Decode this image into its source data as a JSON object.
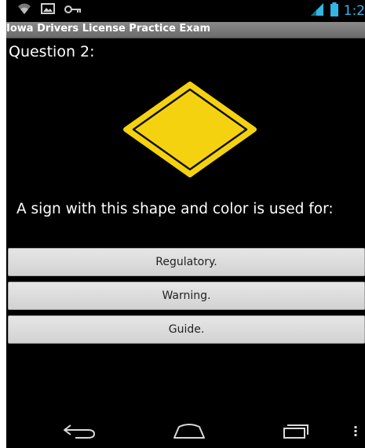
{
  "app": {
    "title": "Iowa Drivers License Practice Exam"
  },
  "status_bar": {
    "time": "1:2",
    "icons": [
      "wifi-icon",
      "image-icon",
      "key-icon",
      "signal-icon",
      "battery-icon"
    ],
    "accent_color": "#33b5e5"
  },
  "question": {
    "number_label": "Question 2:",
    "sign_icon": "diamond-warning-sign-icon",
    "sign_color": "#f5d20f",
    "text": "A sign with this shape and color is used for:"
  },
  "answers": [
    {
      "label": "Regulatory."
    },
    {
      "label": "Warning."
    },
    {
      "label": "Guide."
    }
  ],
  "nav_bar": {
    "icons": [
      "back-icon",
      "home-icon",
      "recent-apps-icon",
      "menu-icon"
    ]
  }
}
